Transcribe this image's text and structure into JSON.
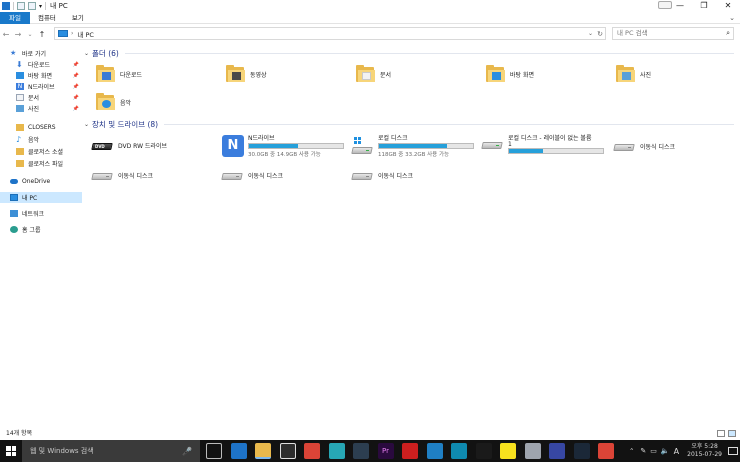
{
  "window": {
    "title": "내 PC",
    "controls": {
      "minimize": "—",
      "maximize": "❐",
      "close": "✕"
    }
  },
  "ribbon": {
    "tabs": [
      "파일",
      "컴퓨터",
      "보기"
    ],
    "expand": "⌄"
  },
  "address": {
    "back": "←",
    "forward": "→",
    "recent": "⌄",
    "up": "↑",
    "path": "내 PC",
    "separator": "›",
    "dropdown": "⌄",
    "refresh": "↻",
    "search_placeholder": "내 PC 검색",
    "search_icon": "⌕"
  },
  "sidebar": {
    "items": [
      {
        "label": "바로 가기",
        "icon": "star-icon",
        "color": "#3a7bd5",
        "pinned": false
      },
      {
        "label": "다운로드",
        "icon": "download-icon",
        "color": "#3a7bd5",
        "pinned": true
      },
      {
        "label": "바탕 화면",
        "icon": "desktop-icon",
        "color": "#2a8ee0",
        "pinned": true
      },
      {
        "label": "N드라이브",
        "icon": "ndrive-icon",
        "color": "#3b7ddd",
        "pinned": true
      },
      {
        "label": "문서",
        "icon": "document-icon",
        "color": "#9aa5b5",
        "pinned": true
      },
      {
        "label": "사진",
        "icon": "pictures-icon",
        "color": "#5aa0d8",
        "pinned": true
      },
      {
        "label": "CLOSERS",
        "icon": "folder-icon",
        "color": "#e8b84c",
        "pinned": false
      },
      {
        "label": "음악",
        "icon": "music-icon",
        "color": "#2a8ee0",
        "pinned": false
      },
      {
        "label": "클로저스 소셜",
        "icon": "folder-icon",
        "color": "#e8b84c",
        "pinned": false
      },
      {
        "label": "클로저스 파일",
        "icon": "folder-icon",
        "color": "#e8b84c",
        "pinned": false
      },
      {
        "label": "OneDrive",
        "icon": "onedrive-icon",
        "color": "#1e73c8",
        "pinned": false
      },
      {
        "label": "내 PC",
        "icon": "pc-icon",
        "color": "#2a8ee0",
        "pinned": false,
        "selected": true
      },
      {
        "label": "네트워크",
        "icon": "network-icon",
        "color": "#3d8fd6",
        "pinned": false
      },
      {
        "label": "홈 그룹",
        "icon": "homegroup-icon",
        "color": "#2a9d8f",
        "pinned": false
      }
    ],
    "pin_glyph": "📌"
  },
  "folders": {
    "header": "폴더 (6)",
    "items": [
      {
        "label": "다운로드",
        "icon": "downloads-folder-icon",
        "overlay": "#3a7bd5"
      },
      {
        "label": "동영상",
        "icon": "videos-folder-icon",
        "overlay": "#4a4a4a"
      },
      {
        "label": "문서",
        "icon": "documents-folder-icon",
        "overlay": "#f2f2f2"
      },
      {
        "label": "바탕 화면",
        "icon": "desktop-folder-icon",
        "overlay": "#2a8ee0"
      },
      {
        "label": "사진",
        "icon": "pictures-folder-icon",
        "overlay": "#5aa0d8"
      },
      {
        "label": "음악",
        "icon": "music-folder-icon",
        "overlay": "#2a8ee0"
      }
    ]
  },
  "devices": {
    "header": "장치 및 드라이브 (8)",
    "items": [
      {
        "label": "DVD RW 드라이브",
        "icon": "dvd-drive-icon"
      },
      {
        "label": "N드라이브",
        "icon": "ndrive-drive-icon",
        "usage": 0.52,
        "sub": "30.0GB 중 14.9GB 사용 가능"
      },
      {
        "label": "로컬 디스크",
        "icon": "local-disk-icon",
        "usage": 0.72,
        "sub": "118GB 중 33.2GB 사용 가능"
      },
      {
        "label": "로컬 디스크 - 레이블이 없는 볼륨",
        "label2": "1",
        "icon": "local-disk-icon",
        "usage": 0.36
      },
      {
        "label": "이동식 디스크",
        "icon": "removable-disk-icon"
      },
      {
        "label": "이동식 디스크",
        "icon": "removable-disk-icon"
      },
      {
        "label": "이동식 디스크",
        "icon": "removable-disk-icon"
      },
      {
        "label": "이동식 디스크",
        "icon": "removable-disk-icon"
      }
    ]
  },
  "status": {
    "count": "14개 항목"
  },
  "taskbar": {
    "search_placeholder": "웹 및 Windows 검색",
    "mic": "🎤",
    "apps": [
      {
        "name": "task-view-icon",
        "color": "#121212",
        "border": "#bbbbbb"
      },
      {
        "name": "edge-icon",
        "color": "#1e73c8"
      },
      {
        "name": "file-explorer-icon",
        "color": "#e8b84c",
        "active": true
      },
      {
        "name": "store-icon",
        "color": "#2d2d2d",
        "border": "#dddddd"
      },
      {
        "name": "chrome-icon",
        "color": "#db4437"
      },
      {
        "name": "app-teal-icon",
        "color": "#27a7b5"
      },
      {
        "name": "app-dark-icon",
        "color": "#2c3e50"
      },
      {
        "name": "premiere-icon",
        "color": "#2a0a3e",
        "text": "Pr"
      },
      {
        "name": "acrobat-icon",
        "color": "#cc1f1f"
      },
      {
        "name": "app-blue-icon",
        "color": "#1f7fc4"
      },
      {
        "name": "app-cyan-icon",
        "color": "#0f8ab0"
      },
      {
        "name": "tiktok-icon",
        "color": "#1a1a1a"
      },
      {
        "name": "kakaotalk-icon",
        "color": "#f7e11e"
      },
      {
        "name": "app-silver-icon",
        "color": "#9ea4ad"
      },
      {
        "name": "app-navy-icon",
        "color": "#3747a3"
      },
      {
        "name": "steam-icon",
        "color": "#1b2838"
      },
      {
        "name": "chrome2-icon",
        "color": "#db4437"
      }
    ],
    "tray": {
      "chevron": "⌃",
      "pen": "✎",
      "network": "▭",
      "volume": "🔈",
      "lang": "A"
    },
    "time": "오후 5:28",
    "date": "2015-07-29"
  }
}
